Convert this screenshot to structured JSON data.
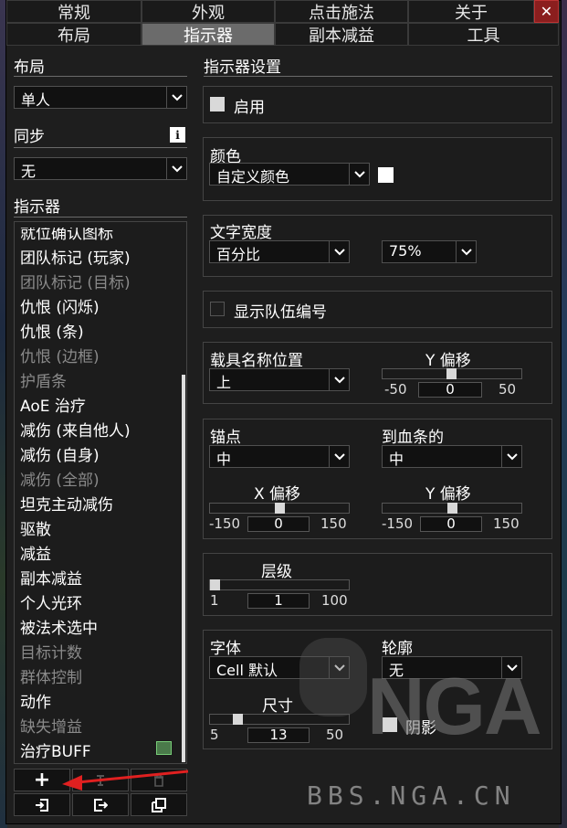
{
  "tabs_row1": [
    "常规",
    "外观",
    "点击施法",
    "关于"
  ],
  "tabs_row2": [
    "布局",
    "指示器",
    "副本减益",
    "工具"
  ],
  "close_glyph": "✕",
  "left": {
    "layout_label": "布局",
    "layout_value": "单人",
    "sync_label": "同步",
    "sync_value": "无",
    "indicators_label": "指示器",
    "items": [
      {
        "label": "就位确认图标",
        "enabled": true
      },
      {
        "label": "团队标记 (玩家)",
        "enabled": true
      },
      {
        "label": "团队标记 (目标)",
        "enabled": false
      },
      {
        "label": "仇恨 (闪烁)",
        "enabled": true
      },
      {
        "label": "仇恨 (条)",
        "enabled": true
      },
      {
        "label": "仇恨 (边框)",
        "enabled": false
      },
      {
        "label": "护盾条",
        "enabled": false
      },
      {
        "label": "AoE 治疗",
        "enabled": true
      },
      {
        "label": "减伤 (来自他人)",
        "enabled": true
      },
      {
        "label": "减伤 (自身)",
        "enabled": true
      },
      {
        "label": "减伤 (全部)",
        "enabled": false
      },
      {
        "label": "坦克主动减伤",
        "enabled": true
      },
      {
        "label": "驱散",
        "enabled": true
      },
      {
        "label": "减益",
        "enabled": true
      },
      {
        "label": "副本减益",
        "enabled": true
      },
      {
        "label": "个人光环",
        "enabled": true
      },
      {
        "label": "被法术选中",
        "enabled": true
      },
      {
        "label": "目标计数",
        "enabled": false
      },
      {
        "label": "群体控制",
        "enabled": false
      },
      {
        "label": "动作",
        "enabled": true
      },
      {
        "label": "缺失增益",
        "enabled": false
      },
      {
        "label": "治疗BUFF",
        "enabled": true
      }
    ]
  },
  "right": {
    "title": "指示器设置",
    "enable_label": "启用",
    "color_label": "颜色",
    "color_value": "自定义颜色",
    "text_width_label": "文字宽度",
    "text_width_mode": "百分比",
    "text_width_value": "75%",
    "show_group_label": "显示队伍编号",
    "vehicle_pos_label": "载具名称位置",
    "vehicle_pos_value": "上",
    "y_offset_label": "Y 偏移",
    "y1_min": "-50",
    "y1_val": "0",
    "y1_max": "50",
    "anchor_label": "锚点",
    "anchor_value": "中",
    "to_bar_label": "到血条的",
    "to_bar_value": "中",
    "x_offset_label": "X 偏移",
    "x_min": "-150",
    "x_val": "0",
    "x_max": "150",
    "y2_label": "Y 偏移",
    "y2_min": "-150",
    "y2_val": "0",
    "y2_max": "150",
    "level_label": "层级",
    "level_min": "1",
    "level_val": "1",
    "level_max": "100",
    "font_label": "字体",
    "font_value": "Cell 默认",
    "outline_label": "轮廓",
    "outline_value": "无",
    "size_label": "尺寸",
    "size_min": "5",
    "size_val": "13",
    "size_max": "50",
    "shadow_label": "阴影"
  },
  "buttons": {
    "add": "+"
  },
  "watermark": {
    "brand": "NGA",
    "url": "BBS.NGA.CN"
  },
  "colors": {
    "accent_arrow": "#e02020",
    "tab_active": "#6b6b6b",
    "close": "#8b1e1e"
  }
}
